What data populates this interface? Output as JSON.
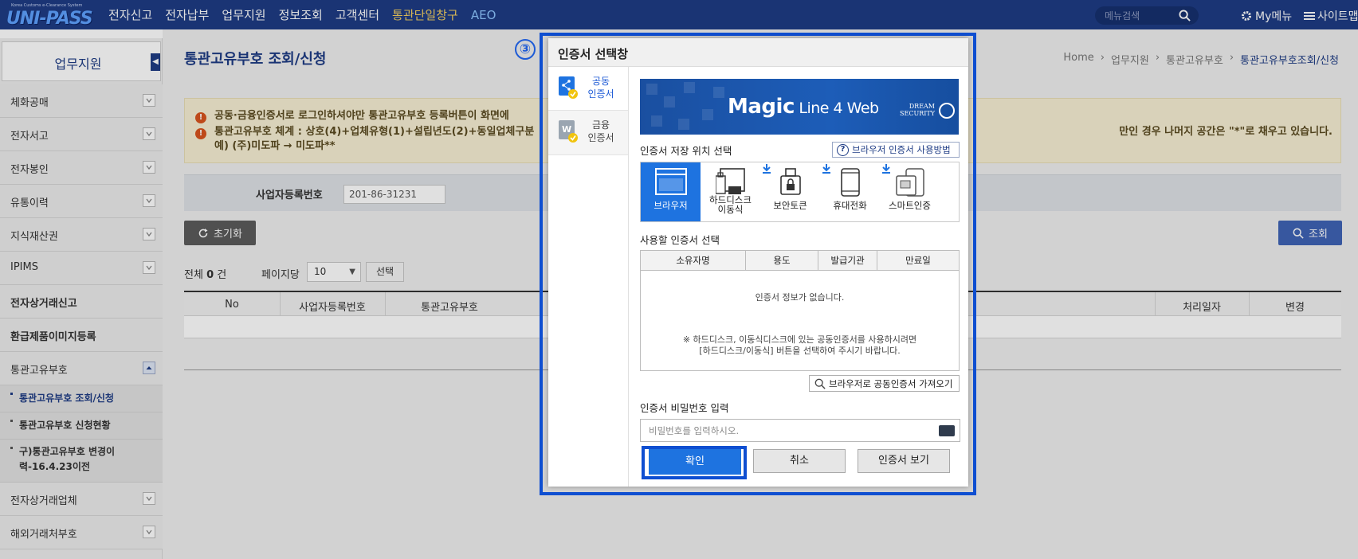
{
  "header": {
    "logo_text": "UNI-PASS",
    "logo_tagline": "Korea Customs e-Clearance System",
    "nav": [
      "전자신고",
      "전자납부",
      "업무지원",
      "정보조회",
      "고객센터",
      "통관단일창구",
      "AEO"
    ],
    "menu_search_placeholder": "메뉴검색",
    "my_menu": "My메뉴",
    "sitemap": "사이트맵"
  },
  "sidebar": {
    "title": "업무지원",
    "items": [
      {
        "label": "체화공매",
        "bold": false
      },
      {
        "label": "전자서고",
        "bold": false
      },
      {
        "label": "전자봉인",
        "bold": false
      },
      {
        "label": "유통이력",
        "bold": false
      },
      {
        "label": "지식재산권",
        "bold": false
      },
      {
        "label": "IPIMS",
        "bold": false
      },
      {
        "label": "전자상거래신고",
        "bold": true
      },
      {
        "label": "환급제품이미지등록",
        "bold": true
      },
      {
        "label": "통관고유부호",
        "bold": false
      }
    ],
    "subitems": [
      "통관고유부호 조회/신청",
      "통관고유부호 신청현황",
      "구)통관고유부호 변경이력-16.4.23이전"
    ],
    "more_items": [
      "전자상거래업체",
      "해외거래처부호"
    ]
  },
  "main": {
    "page_title": "통관고유부호 조회/신청",
    "breadcrumb": [
      "Home",
      "업무지원",
      "통관고유부호",
      "통관고유부호조회/신청"
    ],
    "notice_line1": "공동·금융인증서로 로그인하셔야만 통관고유부호 등록버튼이 화면에 ",
    "notice_line2": "통관고유부호 체계 : 상호(4)+업체유형(1)+설립년도(2)+동일업체구분",
    "notice_line2_tail": "만인 경우 나머지 공간은 \"*\"로 채우고 있습니다.",
    "notice_line3": "예) (주)미도파 → 미도파**",
    "search_label": "사업자등록번호",
    "search_value": "201-86-31231",
    "reset_label": "초기화",
    "search_button": "조회",
    "total_prefix": "전체 ",
    "total_count": "0",
    "total_suffix": " 건",
    "perpage_label": "페이지당",
    "perpage_value": "10",
    "perpage_button": "선택",
    "columns": [
      "No",
      "사업자등록번호",
      "통관고유부호",
      "처리일자",
      "변경"
    ]
  },
  "modal": {
    "step": "③",
    "title": "인증서 선택창",
    "tabs": [
      {
        "line1": "공동",
        "line2": "인증서"
      },
      {
        "line1": "금융",
        "line2": "인증서"
      }
    ],
    "banner_main": "Magic",
    "banner_sub": " Line 4 Web",
    "banner_brand1": "DREAM",
    "banner_brand2": "SECURITY",
    "location_label": "인증서 저장 위치 선택",
    "help_label": "브라우저 인증서 사용방법",
    "locations": [
      {
        "label": "브라우저",
        "selected": true
      },
      {
        "label": "하드디스크\n이동식",
        "selected": false
      },
      {
        "label": "보안토큰",
        "selected": false
      },
      {
        "label": "휴대전화",
        "selected": false
      },
      {
        "label": "스마트인증",
        "selected": false
      }
    ],
    "select_label": "사용할 인증서 선택",
    "table_headers": [
      "소유자명",
      "용도",
      "발급기관",
      "만료일"
    ],
    "empty_text": "인증서 정보가 없습니다.",
    "note_line1": "※ 하드디스크, 이동식디스크에 있는 공동인증서를 사용하시려면",
    "note_line2": "[하드디스크/이동식] 버튼을 선택하여 주시기 바랍니다.",
    "import_label": "브라우저로 공동인증서 가져오기",
    "password_label": "인증서 비밀번호 입력",
    "password_placeholder": "비밀번호를 입력하시오.",
    "ok": "확인",
    "cancel": "취소",
    "view": "인증서 보기"
  }
}
